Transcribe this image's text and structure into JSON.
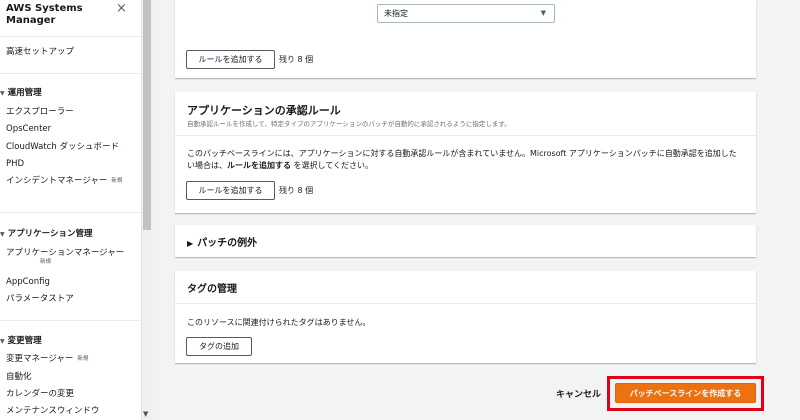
{
  "sidebar": {
    "title_line1": "AWS Systems",
    "title_line2": "Manager",
    "close_icon": "×",
    "quick_setup": "高速セットアップ",
    "sections": {
      "ops": {
        "label": "運用管理",
        "items": [
          "エクスプローラー",
          "OpsCenter",
          "CloudWatch ダッシュボード",
          "PHD",
          "インシデントマネージャー"
        ]
      },
      "app": {
        "label": "アプリケーション管理",
        "items": [
          "アプリケーションマネージャー",
          "AppConfig",
          "パラメータストア"
        ]
      },
      "change": {
        "label": "変更管理",
        "items": [
          "変更マネージャー",
          "自動化",
          "カレンダーの変更",
          "メンテナンスウィンドウ"
        ]
      }
    },
    "new_badge": "新規",
    "caret": "▼"
  },
  "top_panel": {
    "select_value": "未指定",
    "add_rule_button": "ルールを追加する",
    "remaining": "残り 8 個"
  },
  "approval_panel": {
    "title": "アプリケーションの承認ルール",
    "description": "自動承認ルールを作成して、特定タイプのアプリケーションのパッチが自動的に承認されるように指定します。",
    "body_line1": "このパッチベースラインには、アプリケーションに対する自動承認ルールが含まれていません。Microsoft アプリケーションパッチに自動承認を追加した",
    "body_line2_pre": "い場合は、",
    "body_line2_bold": "ルールを追加する",
    "body_line2_post": " を選択してください。",
    "add_rule_button": "ルールを追加する",
    "remaining": "残り 8 個"
  },
  "exceptions_panel": {
    "title": "パッチの例外",
    "caret": "▶"
  },
  "tags_panel": {
    "title": "タグの管理",
    "empty_text": "このリソースに関連付けられたタグはありません。",
    "add_tag_button": "タグの追加"
  },
  "footer": {
    "cancel": "キャンセル",
    "create": "パッチベースラインを作成する"
  },
  "colors": {
    "primary": "#ec7211",
    "highlight": "#e0001b",
    "background": "#f2f3f3"
  }
}
